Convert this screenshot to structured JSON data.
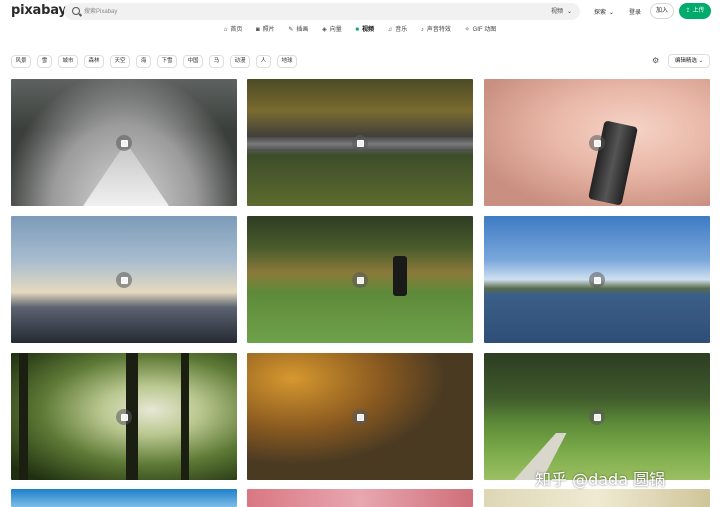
{
  "header": {
    "logo": "pixabay",
    "search_placeholder": "搜索Pixabay",
    "search_filter": "视频",
    "explore": "探索",
    "login": "登录",
    "join": "加入",
    "upload": "上传"
  },
  "nav": [
    {
      "icon": "home-icon",
      "glyph": "⌂",
      "label": "首页",
      "active": false
    },
    {
      "icon": "camera-icon",
      "glyph": "◙",
      "label": "照片",
      "active": false
    },
    {
      "icon": "brush-icon",
      "glyph": "✎",
      "label": "插画",
      "active": false
    },
    {
      "icon": "vector-icon",
      "glyph": "◈",
      "label": "向量",
      "active": false
    },
    {
      "icon": "video-icon",
      "glyph": "■",
      "label": "视频",
      "active": true
    },
    {
      "icon": "music-icon",
      "glyph": "♫",
      "label": "音乐",
      "active": false
    },
    {
      "icon": "sound-effects-icon",
      "glyph": "♪",
      "label": "声音特效",
      "active": false
    },
    {
      "icon": "gif-icon",
      "glyph": "✧",
      "label": "GIF 动图",
      "active": false
    }
  ],
  "tags": [
    "风景",
    "雪",
    "城市",
    "森林",
    "天空",
    "海",
    "下雪",
    "中国",
    "马",
    "动漫",
    "人",
    "地球"
  ],
  "sort": "编辑精选",
  "accent_color": "#00ab6b",
  "watermark": "知乎 @dada 圆锅"
}
